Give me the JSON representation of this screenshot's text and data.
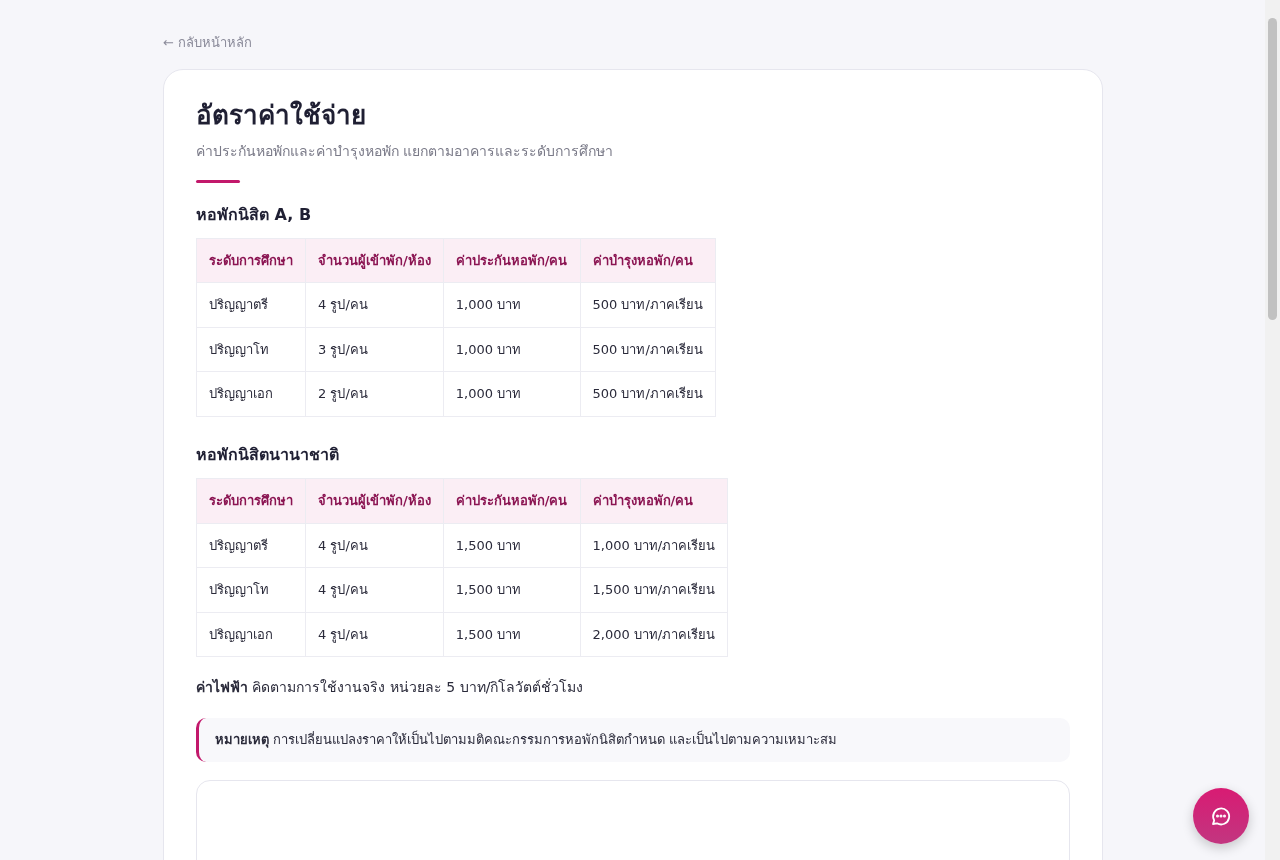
{
  "back_link": "← กลับหน้าหลัก",
  "title": "อัตราค่าใช้จ่าย",
  "subtitle": "ค่าประกันหอพักและค่าบำรุงหอพัก แยกตามอาคารและระดับการศึกษา",
  "sections": [
    {
      "heading": "หอพักนิสิต A, B",
      "table": {
        "columns": [
          "ระดับการศึกษา",
          "จำนวนผู้เข้าพัก/ห้อง",
          "ค่าประกันหอพัก/คน",
          "ค่าบำรุงหอพัก/คน"
        ],
        "rows": [
          [
            "ปริญญาตรี",
            "4 รูป/คน",
            "1,000 บาท",
            "500 บาท/ภาคเรียน"
          ],
          [
            "ปริญญาโท",
            "3 รูป/คน",
            "1,000 บาท",
            "500 บาท/ภาคเรียน"
          ],
          [
            "ปริญญาเอก",
            "2 รูป/คน",
            "1,000 บาท",
            "500 บาท/ภาคเรียน"
          ]
        ]
      }
    },
    {
      "heading": "หอพักนิสิตนานาชาติ",
      "table": {
        "columns": [
          "ระดับการศึกษา",
          "จำนวนผู้เข้าพัก/ห้อง",
          "ค่าประกันหอพัก/คน",
          "ค่าบำรุงหอพัก/คน"
        ],
        "rows": [
          [
            "ปริญญาตรี",
            "4 รูป/คน",
            "1,500 บาท",
            "1,000 บาท/ภาคเรียน"
          ],
          [
            "ปริญญาโท",
            "4 รูป/คน",
            "1,500 บาท",
            "1,500 บาท/ภาคเรียน"
          ],
          [
            "ปริญญาเอก",
            "4 รูป/คน",
            "1,500 บาท",
            "2,000 บาท/ภาคเรียน"
          ]
        ]
      }
    }
  ],
  "electricity": "**ค่าไฟฟ้า** คิดตามการใช้งานจริง หน่วยละ 5 บาท/กิโลวัตต์ชั่วโมง",
  "note": "**หมายเหตุ** การเปลี่ยนแปลงราคาให้เป็นไปตามมติคณะกรรมการหอพักนิสิตกำหนด และเป็นไปตามความเหมาะสม"
}
